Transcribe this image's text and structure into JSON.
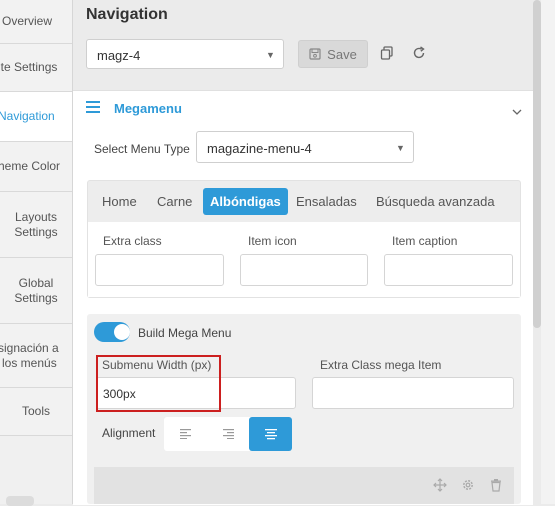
{
  "sidebar": {
    "items": [
      {
        "label": "Overview"
      },
      {
        "label": "ite Settings"
      },
      {
        "label": "Navigation"
      },
      {
        "label": "heme Color"
      },
      {
        "label_line1": "Layouts",
        "label_line2": "Settings"
      },
      {
        "label_line1": "Global",
        "label_line2": "Settings"
      },
      {
        "label_line1": "signación a",
        "label_line2": "los menús"
      },
      {
        "label": "Tools"
      }
    ]
  },
  "header": {
    "title": "Navigation",
    "menu_select_value": "magz-4",
    "save_label": "Save"
  },
  "panel": {
    "title": "Megamenu",
    "select_type_label": "Select Menu Type",
    "select_type_value": "magazine-menu-4",
    "tabs": [
      {
        "label": "Home"
      },
      {
        "label": "Carne"
      },
      {
        "label": "Albóndigas"
      },
      {
        "label": "Ensaladas"
      },
      {
        "label": "Búsqueda avanzada"
      }
    ],
    "fields": [
      {
        "label": "Extra class",
        "value": ""
      },
      {
        "label": "Item icon",
        "value": ""
      },
      {
        "label": "Item caption",
        "value": ""
      }
    ],
    "build": {
      "toggle_label": "Build Mega Menu",
      "toggle_on": true,
      "submenu_width_label": "Submenu Width (px)",
      "submenu_width_value": "300px",
      "extra_class_mega_label": "Extra Class mega Item",
      "extra_class_mega_value": "",
      "alignment_label": "Alignment",
      "alignment_selected": "center"
    }
  },
  "colors": {
    "accent": "#2e9ad8",
    "highlight": "#cc1f1f"
  }
}
